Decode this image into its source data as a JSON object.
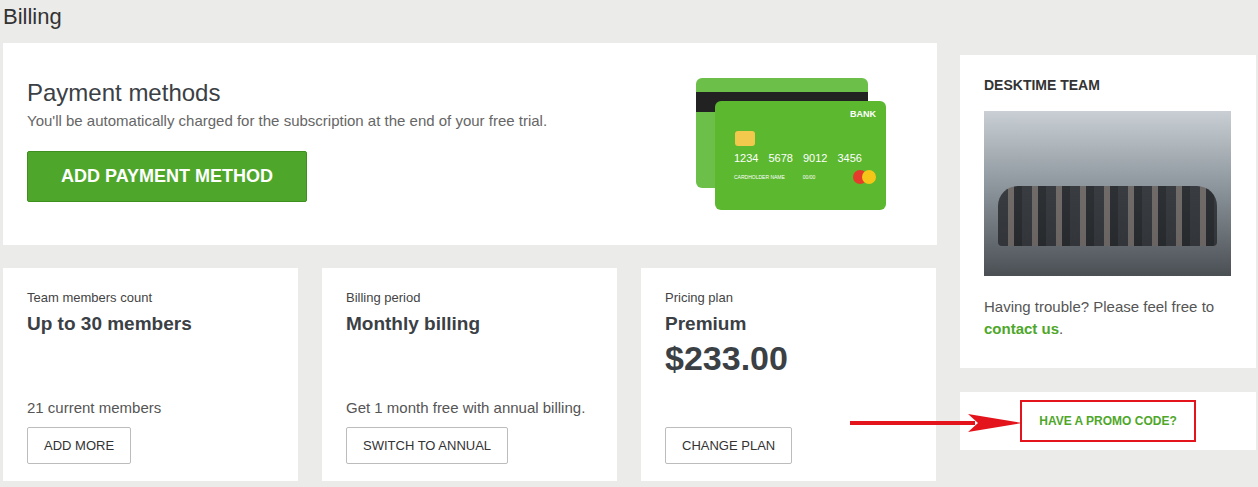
{
  "page": {
    "title": "Billing"
  },
  "payment": {
    "title": "Payment methods",
    "description": "You'll be automatically charged for the subscription at the end of your free trial.",
    "button": "ADD PAYMENT METHOD",
    "card": {
      "bank": "BANK",
      "number": [
        "1234",
        "5678",
        "9012",
        "3456"
      ],
      "holder": "CARDHOLDER NAME",
      "expiry": "00/00"
    }
  },
  "summary": [
    {
      "label": "Team members count",
      "value": "Up to 30 members",
      "note": "21 current members",
      "button": "ADD MORE"
    },
    {
      "label": "Billing period",
      "value": "Monthly billing",
      "note": "Get 1 month free with annual billing.",
      "button": "SWITCH TO ANNUAL"
    },
    {
      "label": "Pricing plan",
      "value": "Premium",
      "price": "$233.00",
      "button": "CHANGE PLAN"
    }
  ],
  "team": {
    "title": "DESKTIME TEAM",
    "help": "Having trouble? Please feel free to ",
    "link": "contact us",
    "after": "."
  },
  "promo": {
    "link": "HAVE A PROMO CODE?"
  }
}
